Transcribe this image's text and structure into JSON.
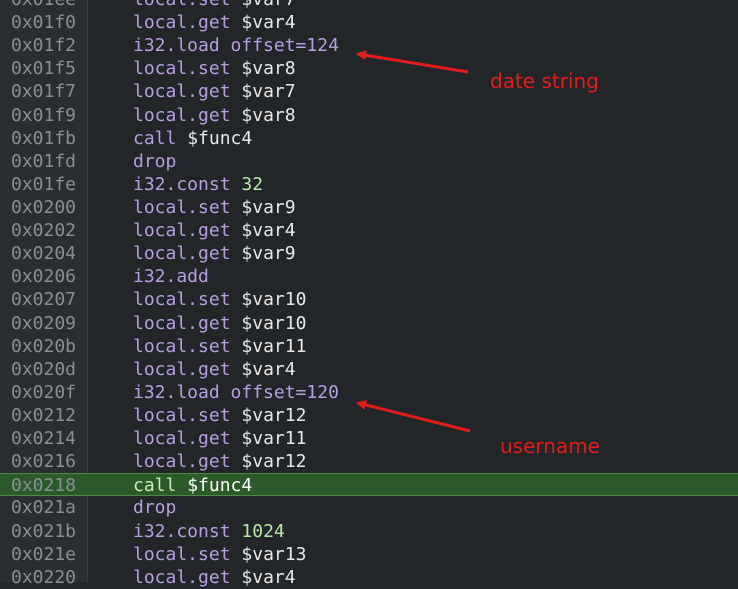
{
  "lines": [
    {
      "addr": "0x01ee",
      "op": "local.set",
      "arg": "$var7"
    },
    {
      "addr": "0x01f0",
      "op": "local.get",
      "arg": "$var4"
    },
    {
      "addr": "0x01f2",
      "op": "i32.load offset=124",
      "arg": ""
    },
    {
      "addr": "0x01f5",
      "op": "local.set",
      "arg": "$var8"
    },
    {
      "addr": "0x01f7",
      "op": "local.get",
      "arg": "$var7"
    },
    {
      "addr": "0x01f9",
      "op": "local.get",
      "arg": "$var8"
    },
    {
      "addr": "0x01fb",
      "op": "call",
      "arg": "$func4"
    },
    {
      "addr": "0x01fd",
      "op": "drop",
      "arg": ""
    },
    {
      "addr": "0x01fe",
      "op": "i32.const",
      "arg": "",
      "num": "32"
    },
    {
      "addr": "0x0200",
      "op": "local.set",
      "arg": "$var9"
    },
    {
      "addr": "0x0202",
      "op": "local.get",
      "arg": "$var4"
    },
    {
      "addr": "0x0204",
      "op": "local.get",
      "arg": "$var9"
    },
    {
      "addr": "0x0206",
      "op": "i32.add",
      "arg": ""
    },
    {
      "addr": "0x0207",
      "op": "local.set",
      "arg": "$var10"
    },
    {
      "addr": "0x0209",
      "op": "local.get",
      "arg": "$var10"
    },
    {
      "addr": "0x020b",
      "op": "local.set",
      "arg": "$var11"
    },
    {
      "addr": "0x020d",
      "op": "local.get",
      "arg": "$var4"
    },
    {
      "addr": "0x020f",
      "op": "i32.load offset=120",
      "arg": ""
    },
    {
      "addr": "0x0212",
      "op": "local.set",
      "arg": "$var12"
    },
    {
      "addr": "0x0214",
      "op": "local.get",
      "arg": "$var11"
    },
    {
      "addr": "0x0216",
      "op": "local.get",
      "arg": "$var12"
    },
    {
      "addr": "0x0218",
      "op": "call",
      "arg": "$func4",
      "highlight": true
    },
    {
      "addr": "0x021a",
      "op": "drop",
      "arg": ""
    },
    {
      "addr": "0x021b",
      "op": "i32.const",
      "arg": "",
      "num": "1024"
    },
    {
      "addr": "0x021e",
      "op": "local.set",
      "arg": "$var13"
    },
    {
      "addr": "0x0220",
      "op": "local.get",
      "arg": "$var4"
    }
  ],
  "annotations": {
    "date": "date string",
    "user": "username"
  },
  "colors": {
    "background": "#232629",
    "keyword": "#b79fe0",
    "constant": "#b7e8a8",
    "highlight": "#2d5a2a",
    "annotation": "#e51c1c"
  }
}
